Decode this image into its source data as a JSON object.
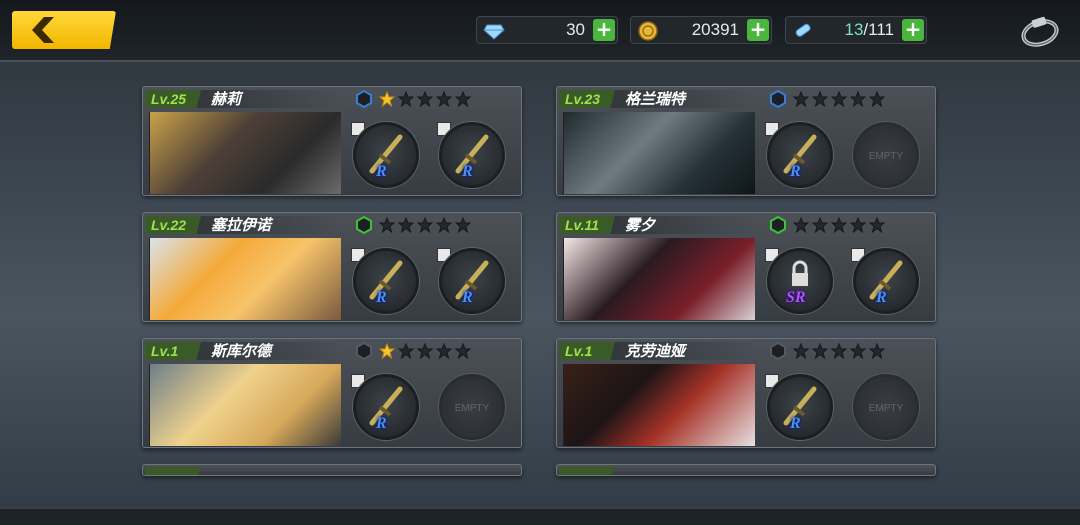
{
  "header": {
    "back_icon": "chevron-left-icon",
    "resources": [
      {
        "icon": "diamond-icon",
        "value": "30"
      },
      {
        "icon": "gold-coin-icon",
        "value": "20391"
      },
      {
        "icon": "stamina-vial-icon",
        "value_current": "13",
        "value_max": "/111"
      }
    ],
    "ring_icon": "ring-icon"
  },
  "cards": [
    {
      "level": "Lv.25",
      "name": "赫莉",
      "rank_color": "#3a7cd6",
      "stars": 1,
      "slots": [
        {
          "rarity": "R",
          "empty": false
        },
        {
          "rarity": "R",
          "empty": false
        }
      ]
    },
    {
      "level": "Lv.23",
      "name": "格兰瑞特",
      "rank_color": "#3a7cd6",
      "stars": 0,
      "slots": [
        {
          "rarity": "R",
          "empty": false
        },
        {
          "label": "EMPTY",
          "empty": true
        }
      ]
    },
    {
      "level": "Lv.22",
      "name": "塞拉伊诺",
      "rank_color": "#3ec23a",
      "stars": 0,
      "slots": [
        {
          "rarity": "R",
          "empty": false
        },
        {
          "rarity": "R",
          "empty": false
        }
      ]
    },
    {
      "level": "Lv.11",
      "name": "雾夕",
      "rank_color": "#3ec23a",
      "stars": 0,
      "slots": [
        {
          "rarity": "SR",
          "empty": false,
          "locked": true
        },
        {
          "rarity": "R",
          "empty": false
        }
      ]
    },
    {
      "level": "Lv.1",
      "name": "斯库尔德",
      "rank_color": "#555a60",
      "stars": 1,
      "slots": [
        {
          "rarity": "R",
          "empty": false
        },
        {
          "label": "EMPTY",
          "empty": true
        }
      ]
    },
    {
      "level": "Lv.1",
      "name": "克劳迪娅",
      "rank_color": "#555a60",
      "stars": 0,
      "slots": [
        {
          "rarity": "R",
          "empty": false
        },
        {
          "label": "EMPTY",
          "empty": true
        }
      ]
    }
  ],
  "colors": {
    "accent_yellow": "#f2b600",
    "plus_green": "#4bb63e",
    "level_green": "#9fe34c",
    "star_gold": "#f7c72a"
  }
}
